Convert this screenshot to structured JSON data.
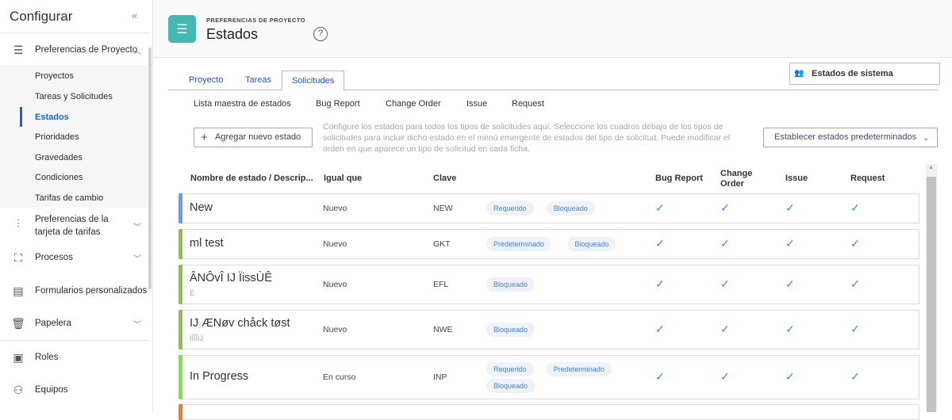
{
  "sidebar": {
    "title": "Configurar",
    "collapse_icon": "double-chevron-left",
    "sections": [
      {
        "label": "Preferencias de Proyecto",
        "icon": "sliders"
      },
      {
        "label": "Preferencias de la tarjeta de tarifas",
        "icon": "equalizer"
      },
      {
        "label": "Procesos",
        "icon": "process"
      },
      {
        "label": "Formularios personalizados",
        "icon": "form"
      },
      {
        "label": "Papelera",
        "icon": "trash"
      },
      {
        "label": "Roles",
        "icon": "id-card"
      },
      {
        "label": "Equipos",
        "icon": "team"
      }
    ],
    "sub_items": [
      "Proyectos",
      "Tareas y Solicitudes",
      "Estados",
      "Prioridades",
      "Gravedades",
      "Condiciones",
      "Tarifas de cambio"
    ],
    "active_sub": "Estados"
  },
  "header": {
    "supertitle": "PREFERENCIAS DE PROYECTO",
    "title": "Estados",
    "help": "?"
  },
  "tabs": [
    "Proyecto",
    "Tareas",
    "Solicitudes"
  ],
  "active_tab": "Solicitudes",
  "system_select": "Estados de sistema",
  "subtabs": [
    "Lista maestra de estados",
    "Bug Report",
    "Change Order",
    "Issue",
    "Request"
  ],
  "add_button": "Agregar nuevo estado",
  "description": "Configure los estados para todos los tipos de solicitudes aquí. Seleccione los cuadros debajo de los tipos de solicitudes para incluir dicho estado en el menú emergente de estados del tipo de solicitud. Puede modificar el orden en que aparece un tipo de solicitud en cada ficha.",
  "defaults_button": "Establecer estados predeterminados",
  "columns": [
    "Nombre de estado / Descrip...",
    "Igual que",
    "Clave",
    "Bug Report",
    "Change Order",
    "Issue",
    "Request"
  ],
  "check_glyph": "✓",
  "rows": [
    {
      "name": "New",
      "desc": "",
      "equal": "Nuevo",
      "key": "NEW",
      "tags": [
        "Requerido",
        "Bloqueado"
      ],
      "color": "#6a9be8"
    },
    {
      "name": "ml test",
      "desc": "",
      "equal": "Nuevo",
      "key": "GKT",
      "tags": [
        "Predeterminado",
        "Bloqueado"
      ],
      "color": "#8bc34a"
    },
    {
      "name": "ÂNÔvÎ IJ ÏissÙÊ",
      "desc": "Ê",
      "equal": "Nuevo",
      "key": "EFL",
      "tags": [
        "Bloqueado"
      ],
      "color": "#8bc34a"
    },
    {
      "name": "IJ ÆNøv chåck tøst",
      "desc": "ІÎÏĨІJ",
      "equal": "Nuevo",
      "key": "NWE",
      "tags": [
        "Bloqueado"
      ],
      "color": "#8bc34a"
    },
    {
      "name": "In Progress",
      "desc": "",
      "equal": "En curso",
      "key": "INP",
      "tags": [
        "Requerido",
        "Predeterminado",
        "Bloqueado"
      ],
      "color": "#7ee04a"
    }
  ]
}
